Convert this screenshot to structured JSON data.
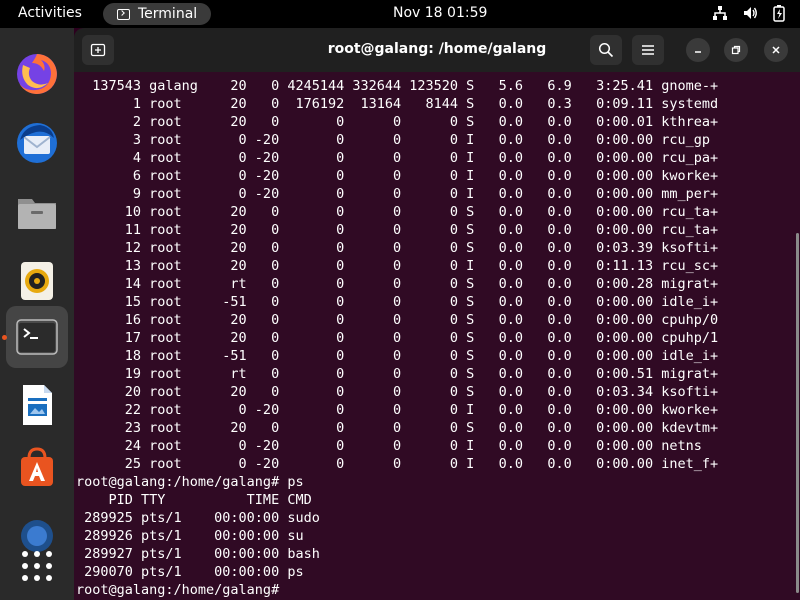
{
  "topbar": {
    "activities": "Activities",
    "app_name": "Terminal",
    "clock": "Nov 18  01:59"
  },
  "dock": {
    "items": [
      {
        "name": "Firefox",
        "icon": "firefox-icon"
      },
      {
        "name": "Thunderbird",
        "icon": "thunderbird-icon"
      },
      {
        "name": "Files",
        "icon": "files-icon"
      },
      {
        "name": "Rhythmbox",
        "icon": "rhythmbox-icon"
      },
      {
        "name": "Terminal",
        "icon": "terminal-icon",
        "active": true
      },
      {
        "name": "LibreOffice Writer",
        "icon": "writer-icon"
      },
      {
        "name": "Ubuntu Software",
        "icon": "software-icon"
      },
      {
        "name": "Help",
        "icon": "help-icon"
      },
      {
        "name": "Show Applications",
        "icon": "app-grid-icon"
      }
    ]
  },
  "window": {
    "title": "root@galang: /home/galang"
  },
  "terminal": {
    "lines": [
      "  137543 galang    20   0 4245144 332644 123520 S   5.6   6.9   3:25.41 gnome-+",
      "       1 root      20   0  176192  13164   8144 S   0.0   0.3   0:09.11 systemd",
      "       2 root      20   0       0      0      0 S   0.0   0.0   0:00.01 kthrea+",
      "       3 root       0 -20       0      0      0 I   0.0   0.0   0:00.00 rcu_gp",
      "       4 root       0 -20       0      0      0 I   0.0   0.0   0:00.00 rcu_pa+",
      "       6 root       0 -20       0      0      0 I   0.0   0.0   0:00.00 kworke+",
      "       9 root       0 -20       0      0      0 I   0.0   0.0   0:00.00 mm_per+",
      "      10 root      20   0       0      0      0 S   0.0   0.0   0:00.00 rcu_ta+",
      "      11 root      20   0       0      0      0 S   0.0   0.0   0:00.00 rcu_ta+",
      "      12 root      20   0       0      0      0 S   0.0   0.0   0:03.39 ksofti+",
      "      13 root      20   0       0      0      0 I   0.0   0.0   0:11.13 rcu_sc+",
      "      14 root      rt   0       0      0      0 S   0.0   0.0   0:00.28 migrat+",
      "      15 root     -51   0       0      0      0 S   0.0   0.0   0:00.00 idle_i+",
      "      16 root      20   0       0      0      0 S   0.0   0.0   0:00.00 cpuhp/0",
      "      17 root      20   0       0      0      0 S   0.0   0.0   0:00.00 cpuhp/1",
      "      18 root     -51   0       0      0      0 S   0.0   0.0   0:00.00 idle_i+",
      "      19 root      rt   0       0      0      0 S   0.0   0.0   0:00.51 migrat+",
      "      20 root      20   0       0      0      0 S   0.0   0.0   0:03.34 ksofti+",
      "      22 root       0 -20       0      0      0 I   0.0   0.0   0:00.00 kworke+",
      "      23 root      20   0       0      0      0 S   0.0   0.0   0:00.00 kdevtm+",
      "      24 root       0 -20       0      0      0 I   0.0   0.0   0:00.00 netns",
      "      25 root       0 -20       0      0      0 I   0.0   0.0   0:00.00 inet_f+",
      "root@galang:/home/galang# ps",
      "    PID TTY          TIME CMD",
      " 289925 pts/1    00:00:00 sudo",
      " 289926 pts/1    00:00:00 su",
      " 289927 pts/1    00:00:00 bash",
      " 290070 pts/1    00:00:00 ps",
      "root@galang:/home/galang# "
    ]
  },
  "colors": {
    "terminal_bg": "#300a24",
    "desktop_bg": "#2c001e",
    "accent": "#e95420"
  }
}
